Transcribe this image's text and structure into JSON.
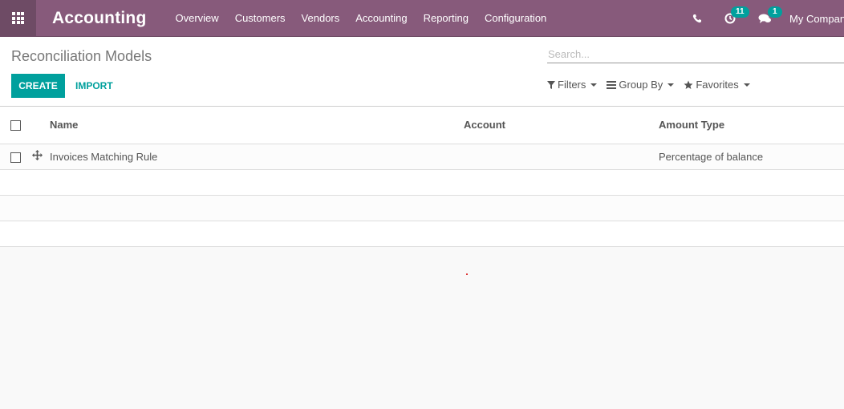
{
  "navbar": {
    "app_name": "Accounting",
    "menu": [
      "Overview",
      "Customers",
      "Vendors",
      "Accounting",
      "Reporting",
      "Configuration"
    ],
    "systray": {
      "phone_icon": "phone-icon",
      "activity_icon": "clock-icon",
      "activity_count": "11",
      "messages_icon": "chat-icon",
      "messages_count": "1",
      "company": "My Company"
    },
    "colors": {
      "primary": "#875a7b",
      "accent": "#00a09d"
    }
  },
  "control_panel": {
    "title": "Reconciliation Models",
    "create_label": "CREATE",
    "import_label": "IMPORT",
    "search_placeholder": "Search...",
    "search_value": "",
    "filters_label": "Filters",
    "group_by_label": "Group By",
    "favorites_label": "Favorites"
  },
  "list": {
    "columns": [
      "Name",
      "Account",
      "Amount Type"
    ],
    "rows": [
      {
        "name": "Invoices Matching Rule",
        "account": "",
        "amount_type": "Percentage of balance"
      }
    ]
  }
}
